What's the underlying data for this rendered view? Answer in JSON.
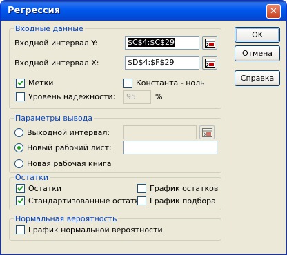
{
  "window": {
    "title": "Регрессия",
    "close_glyph": "✕"
  },
  "input_group": {
    "legend": "Входные данные",
    "y_range_label": "Входной интервал Y:",
    "y_range_value": "$C$4:$C$29",
    "x_range_label": "Входной интервал X:",
    "x_range_value": "$D$4:$F$29",
    "labels_label": "Метки",
    "labels_checked": true,
    "constant_zero_label": "Константа - ноль",
    "constant_zero_checked": false,
    "confidence_label": "Уровень надежности:",
    "confidence_checked": false,
    "confidence_value": "95",
    "percent_sign": "%"
  },
  "output_group": {
    "legend": "Параметры вывода",
    "output_range_label": "Выходной интервал:",
    "output_range_value": "",
    "new_sheet_label": "Новый рабочий лист:",
    "new_sheet_value": "",
    "new_workbook_label": "Новая рабочая книга",
    "selected_option": "new_sheet"
  },
  "residuals_group": {
    "legend": "Остатки",
    "residuals_label": "Остатки",
    "residuals_checked": true,
    "std_residuals_label": "Стандартизованные остатки",
    "std_residuals_checked": true,
    "residual_plot_label": "График остатков",
    "residual_plot_checked": false,
    "line_fit_label": "График подбора",
    "line_fit_checked": false
  },
  "normal_group": {
    "legend": "Нормальная вероятность",
    "normal_plot_label": "График нормальной вероятности",
    "normal_plot_checked": false
  },
  "buttons": {
    "ok": "OK",
    "cancel": "Отмена",
    "help": "Справка"
  },
  "icons": {
    "range_selector": "range-select-icon",
    "check": "check-icon"
  }
}
